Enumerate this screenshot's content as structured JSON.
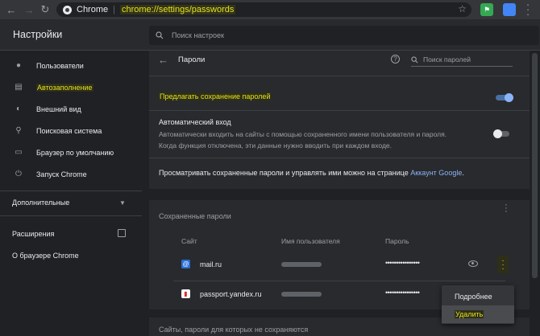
{
  "browser": {
    "omnibox_site": "Chrome",
    "omnibox_url": "chrome://settings/passwords"
  },
  "header": {
    "title": "Настройки",
    "search_placeholder": "Поиск настроек"
  },
  "sidebar": {
    "items": [
      {
        "label": "Пользователи",
        "icon": "person-icon"
      },
      {
        "label": "Автозаполнение",
        "icon": "clipboard-icon"
      },
      {
        "label": "Внешний вид",
        "icon": "palette-icon"
      },
      {
        "label": "Поисковая система",
        "icon": "search-icon"
      },
      {
        "label": "Браузер по умолчанию",
        "icon": "browser-icon"
      },
      {
        "label": "Запуск Chrome",
        "icon": "power-icon"
      }
    ],
    "advanced": "Дополнительные",
    "extensions": "Расширения",
    "about": "О браузере Chrome"
  },
  "passwords": {
    "title": "Пароли",
    "search_placeholder": "Поиск паролей",
    "offer_to_save": "Предлагать сохранение паролей",
    "offer_to_save_enabled": true,
    "auto_signin_title": "Автоматический вход",
    "auto_signin_desc_1": "Автоматически входить на сайты с помощью сохраненного имени пользователя и пароля.",
    "auto_signin_desc_2": "Когда функция отключена, эти данные нужно вводить при каждом входе.",
    "auto_signin_enabled": false,
    "manage_text": "Просматривать сохраненные пароли и управлять ими можно на странице ",
    "manage_link": "Аккаунт Google",
    "manage_end": ".",
    "saved_title": "Сохраненные пароли",
    "columns": {
      "site": "Сайт",
      "username": "Имя пользователя",
      "password": "Пароль"
    },
    "rows": [
      {
        "site": "mail.ru",
        "password_mask": "••••••••••••••••"
      },
      {
        "site": "passport.yandex.ru",
        "password_mask": "••••••••••••••••"
      }
    ],
    "never_saved_title": "Сайты, пароли для которых не сохраняются"
  },
  "menu": {
    "details": "Подробнее",
    "delete": "Удалить"
  }
}
